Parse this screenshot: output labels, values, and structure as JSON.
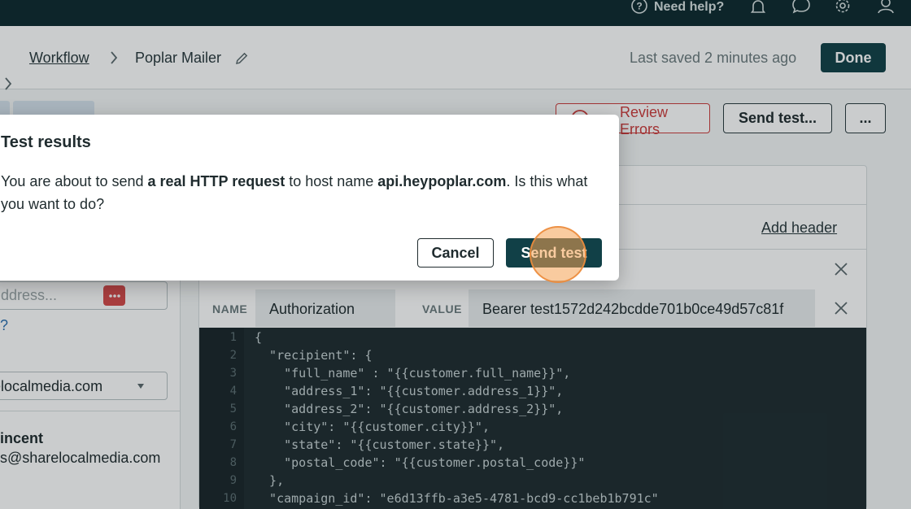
{
  "topbar": {
    "help_label": "Need help?",
    "icons": [
      "bell-icon",
      "chat-icon",
      "gear-icon",
      "user-icon"
    ]
  },
  "breadcrumb": {
    "link": "Workflow",
    "current": "Poplar Mailer"
  },
  "header": {
    "last_saved": "Last saved 2 minutes ago",
    "done_label": "Done"
  },
  "toolbar": {
    "review_errors": "Review Errors",
    "send_test": "Send test...",
    "more": "..."
  },
  "left_panel": {
    "address_placeholder": "ddress...",
    "help_link": "?",
    "domain_value": "elocalmedia.com",
    "user_name": "incent",
    "user_email": "s@sharelocalmedia.com"
  },
  "request_panel": {
    "add_header": "Add header",
    "header_row": {
      "name_label": "NAME",
      "name_value": "Authorization",
      "value_label": "VALUE",
      "value_value": "Bearer test1572d242bcdde701b0ce49d57c81f"
    },
    "code_lines": [
      "{",
      "  \"recipient\": {",
      "    \"full_name\" : \"{{customer.full_name}}\",",
      "    \"address_1\": \"{{customer.address_1}}\",",
      "    \"address_2\": \"{{customer.address_2}}\",",
      "    \"city\": \"{{customer.city}}\",",
      "    \"state\": \"{{customer.state}}\",",
      "    \"postal_code\": \"{{customer.postal_code}}\"",
      "  },",
      "  \"campaign_id\": \"e6d13ffb-a3e5-4781-bcd9-cc1beb1b791c\""
    ],
    "line_numbers": [
      "1",
      "2",
      "3",
      "4",
      "5",
      "6",
      "7",
      "8",
      "9",
      "10"
    ]
  },
  "modal": {
    "title": "Test results",
    "body_prefix": "You are about to send ",
    "body_bold1": "a real HTTP request",
    "body_middle": " to host name ",
    "body_bold2": "api.heypoplar.com",
    "body_suffix": ". Is this what you want to do?",
    "cancel_label": "Cancel",
    "confirm_label": "Send test"
  },
  "colors": {
    "topbar_bg": "#0e2a2f",
    "primary": "#114047",
    "error": "#cc3b3b",
    "code_bg": "#1f2c30"
  }
}
